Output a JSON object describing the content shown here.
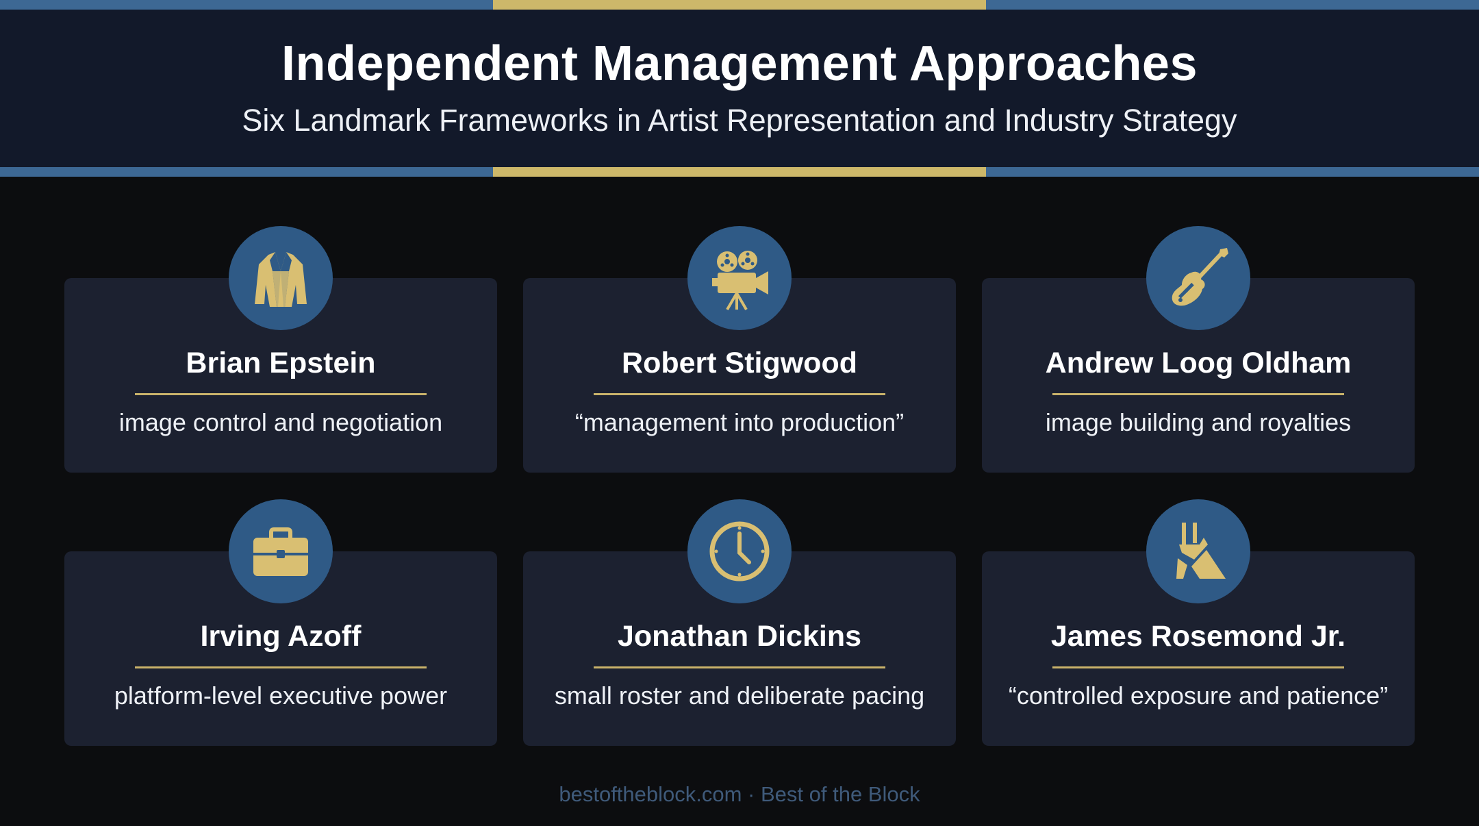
{
  "header": {
    "title": "Independent Management Approaches",
    "subtitle": "Six Landmark Frameworks in Artist Representation and Industry Strategy"
  },
  "colors": {
    "stripe_blue": "#3d6894",
    "stripe_gold": "#cdb86a",
    "badge_blue": "#2f5a86",
    "icon_gold": "#d9bf72",
    "card_bg": "#1c2130"
  },
  "cards": [
    {
      "name": "Brian Epstein",
      "description": "image control and negotiation",
      "icon": "suit-jacket-icon"
    },
    {
      "name": "Robert Stigwood",
      "description": "“management into production”",
      "icon": "film-camera-icon"
    },
    {
      "name": "Andrew Loog Oldham",
      "description": "image building and royalties",
      "icon": "electric-guitar-icon"
    },
    {
      "name": "Irving Azoff",
      "description": "platform-level executive power",
      "icon": "briefcase-icon"
    },
    {
      "name": "Jonathan Dickins",
      "description": "small roster and deliberate pacing",
      "icon": "clock-icon"
    },
    {
      "name": "James Rosemond Jr.",
      "description": "“controlled exposure and patience”",
      "icon": "abstract-monument-icon"
    }
  ],
  "footer": {
    "text": "bestoftheblock.com · Best of the Block"
  }
}
